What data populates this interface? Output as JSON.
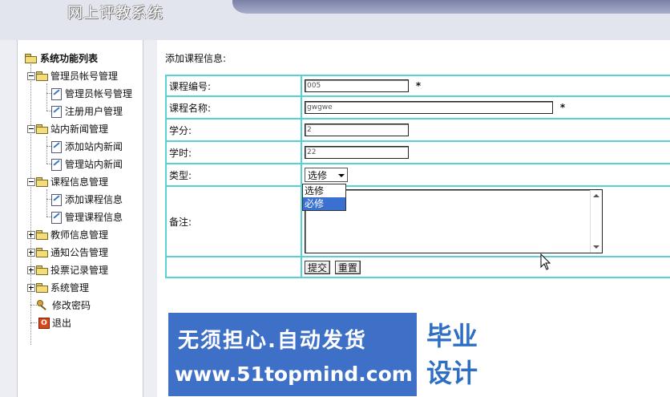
{
  "app": {
    "title": "网上评教系统"
  },
  "sidebar": {
    "root_label": "系统功能列表",
    "groups": [
      {
        "label": "管理员帐号管理",
        "expanded": true,
        "children": [
          "管理员帐号管理",
          "注册用户管理"
        ]
      },
      {
        "label": "站内新闻管理",
        "expanded": true,
        "children": [
          "添加站内新闻",
          "管理站内新闻"
        ]
      },
      {
        "label": "课程信息管理",
        "expanded": true,
        "children": [
          "添加课程信息",
          "管理课程信息"
        ]
      },
      {
        "label": "教师信息管理",
        "expanded": false
      },
      {
        "label": "通知公告管理",
        "expanded": false
      },
      {
        "label": "投票记录管理",
        "expanded": false
      },
      {
        "label": "系统管理",
        "expanded": false
      }
    ],
    "change_password": "修改密码",
    "logout": "退出"
  },
  "form": {
    "title": "添加课程信息:",
    "fields": {
      "course_code": {
        "label": "课程编号:",
        "value": "005",
        "required_mark": "*"
      },
      "course_name": {
        "label": "课程名称:",
        "value": "gwgwe",
        "required_mark": "*"
      },
      "credit": {
        "label": "学分:",
        "value": "2"
      },
      "hours": {
        "label": "学时:",
        "value": "22"
      },
      "type": {
        "label": "类型:",
        "selected": "选修",
        "options": [
          "选修",
          "必修"
        ],
        "highlighted_option": "必修"
      },
      "remark": {
        "label": "备注:",
        "value": ""
      }
    },
    "submit_label": "提交",
    "reset_label": "重置"
  },
  "banner": {
    "slogan": "无须担心.自动发货",
    "url": "www.51topmind.com",
    "word1": "毕业",
    "word2": "设计"
  },
  "colors": {
    "accent_border": "#58d0d4",
    "banner_blue": "#3f70c8",
    "selected_option": "#3a70d0"
  }
}
